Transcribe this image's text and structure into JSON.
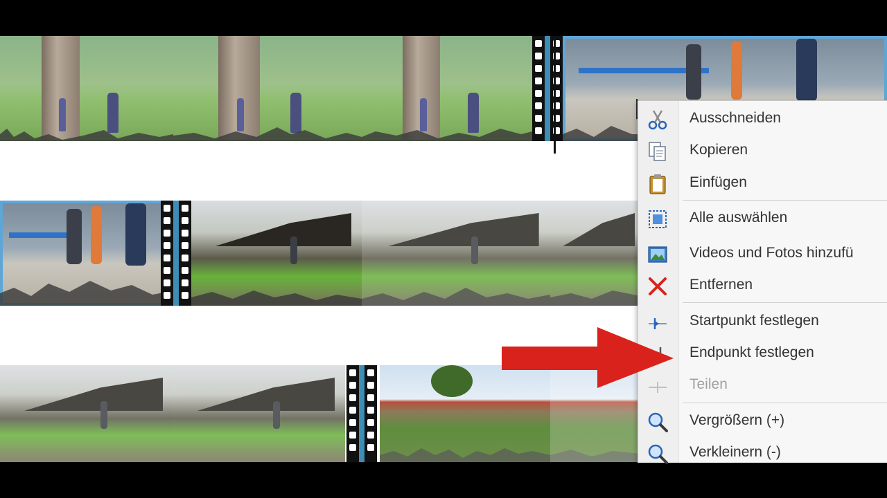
{
  "context_menu": {
    "items": [
      {
        "label": "Ausschneiden",
        "icon": "scissors-icon",
        "enabled": true
      },
      {
        "label": "Kopieren",
        "icon": "copy-icon",
        "enabled": true
      },
      {
        "label": "Einfügen",
        "icon": "paste-icon",
        "enabled": true
      },
      {
        "label": "Alle auswählen",
        "icon": "select-all-icon",
        "enabled": true
      },
      {
        "label": "Videos und Fotos hinzufü",
        "icon": "add-media-icon",
        "enabled": true
      },
      {
        "label": "Entfernen",
        "icon": "remove-icon",
        "enabled": true
      },
      {
        "label": "Startpunkt festlegen",
        "icon": "set-start-point-icon",
        "enabled": true
      },
      {
        "label": "Endpunkt festlegen",
        "icon": "set-end-point-icon",
        "enabled": true
      },
      {
        "label": "Teilen",
        "icon": "split-icon",
        "enabled": false
      },
      {
        "label": "Vergrößern (+)",
        "icon": "zoom-in-icon",
        "enabled": true
      },
      {
        "label": "Verkleinern (-)",
        "icon": "zoom-out-icon",
        "enabled": true
      }
    ]
  },
  "colors": {
    "selection": "#5fa6d6",
    "arrow": "#d9221c",
    "menu_bg": "#f7f7f7"
  },
  "annotation": {
    "icon": "red-arrow-pointer"
  }
}
